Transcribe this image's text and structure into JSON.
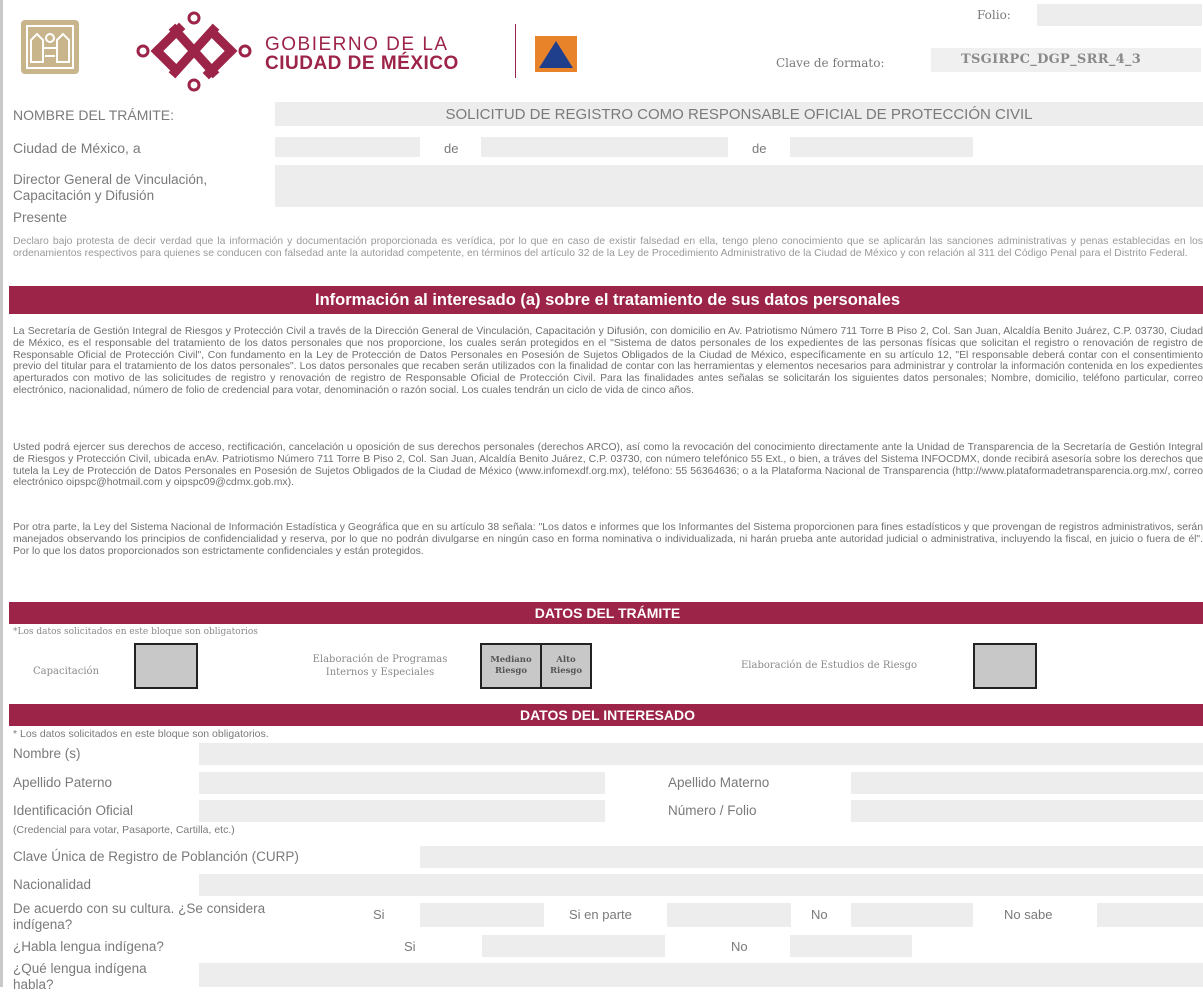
{
  "header": {
    "gov_line1": "GOBIERNO DE LA",
    "gov_line2": "CIUDAD DE MÉXICO",
    "folio_label": "Folio:",
    "folio_value": "",
    "clave_label": "Clave de formato:",
    "clave_value": "TSGIRPC_DGP_SRR_4_3",
    "colors": {
      "brand": "#9d2449",
      "logo_orange": "#e8832a",
      "logo_blue": "#1f3f8c"
    }
  },
  "tramite": {
    "label": "NOMBRE DEL TRÁMITE:",
    "value": "SOLICITUD DE REGISTRO COMO RESPONSABLE OFICIAL DE PROTECCIÓN CIVIL"
  },
  "fecha": {
    "label": "Ciudad de México, a",
    "de1": "de",
    "de2": "de"
  },
  "director": {
    "label_line1": "Director General de Vinculación,",
    "label_line2": "Capacitación y Difusión"
  },
  "presente": "Presente",
  "declaracion": "Declaro bajo protesta de decir verdad que la información y documentación proporcionada es verídica, por lo que en caso de existir falsedad en ella, tengo pleno conocimiento que se aplicarán las sanciones administrativas y penas establecidas en los ordenamientos respectivos para quienes se conducen con falsedad ante la autoridad competente, en términos del artículo 32 de la Ley de Procedimiento Administrativo de la Ciudad de México y con relación al 311 del Código Penal para el Distrito Federal.",
  "privacidad": {
    "title": "Información al interesado (a) sobre el tratamiento de sus datos personales",
    "p1": "La Secretaría de Gestión Integral de Riesgos y Protección Civil a través de la Dirección General de Vinculación, Capacitación y Difusión, con domicilio en Av. Patriotismo Número 711 Torre B Piso 2, Col. San Juan, Alcaldía Benito Juárez, C.P. 03730, Ciudad de México, es el responsable del tratamiento de los datos personales que nos proporcione, los cuales serán protegidos en el \"Sistema de datos personales de los expedientes de las personas físicas que solicitan el registro o renovación de registro de Responsable Oficial de Protección Civil\", Con fundamento en la Ley de Protección de Datos Personales en Posesión de Sujetos Obligados de la Ciudad de México, específicamente en su artículo 12, \"El responsable deberá contar con el consentimiento previo del titular para el tratamiento de los datos personales\". Los datos personales que recaben serán utilizados con la finalidad de contar con las herramientas y elementos necesarios para administrar y controlar la información contenida en los expedientes aperturados con motivo de las solicitudes de registro y renovación de registro de Responsable Oficial de Protección Civil. Para las finalidades antes señalas se solicitarán los siguientes datos personales; Nombre, domicilio, teléfono particular, correo electrónico, nacionalidad, número de folio de credencial para votar, denominación o razón social. Los cuales tendrán un ciclo de vida de cinco años.",
    "p2": "Usted podrá ejercer sus derechos de acceso, rectificación, cancelación u oposición de sus derechos personales (derechos ARCO), así como la revocación del conocimiento directamente ante la Unidad de Transparencia de la Secretaría de Gestión Integral de Riesgos y Protección Civil, ubicada enAv. Patriotismo Número 711 Torre B Piso 2, Col. San Juan, Alcaldía Benito Juárez, C.P. 03730, con número telefónico 55 Ext., o bien, a tráves del Sistema INFOCDMX, donde recibirá asesoría sobre los derechos que tutela la Ley de Protección de Datos Personales en Posesión de Sujetos Obligados de la Ciudad de México (www.infomexdf.org.mx), teléfono: 55 56364636; o a la Plataforma Nacional de Transparencia (http://www.plataformadetransparencia.org.mx/, correo electrónico oipspc@hotmail.com y oipspc09@cdmx.gob.mx).",
    "p3": "Por otra parte, la Ley del Sistema Nacional de Información Estadística y Geográfica que en su artículo 38 señala: \"Los datos e informes que los Informantes del Sistema proporcionen para fines estadísticos y que provengan de registros administrativos, serán manejados observando los principios de confidencialidad y reserva, por lo que no podrán divulgarse en ningún caso en forma nominativa o individualizada, ni harán prueba ante autoridad judicial o administrativa, incluyendo la  fiscal, en juicio o fuera de él\". Por lo que los datos proporcionados son estrictamente confidenciales y están protegidos."
  },
  "datos_tramite": {
    "title": "DATOS DEL TRÁMITE",
    "note": "*Los datos solicitados en este bloque son obligatorios",
    "capacitacion": "Capacitación",
    "programas_line1": "Elaboración de Programas",
    "programas_line2": "Internos y Especiales",
    "mediano_line1": "Mediano",
    "mediano_line2": "Riesgo",
    "alto_line1": "Alto",
    "alto_line2": "Riesgo",
    "estudios": "Elaboración de Estudios de Riesgo"
  },
  "datos_interesado": {
    "title": "DATOS DEL INTERESADO",
    "note": "* Los datos solicitados en este bloque son obligatorios.",
    "nombre": "Nombre (s)",
    "apellido_paterno": "Apellido Paterno",
    "apellido_materno": "Apellido Materno",
    "identificacion": "Identificación Oficial",
    "numero_folio": "Número / Folio",
    "identificacion_nota": "(Credencial para votar, Pasaporte, Cartilla, etc.)",
    "curp": "Clave Única de Registro de Poblanción (CURP)",
    "nacionalidad": "Nacionalidad",
    "indigena_line1": "De acuerdo con su cultura. ¿Se considera",
    "indigena_line2": "indígena?",
    "si": "Si",
    "si_en_parte": "Si en parte",
    "no": "No",
    "no_sabe": "No sabe",
    "lengua": "¿Habla lengua indígena?",
    "lengua_si": "Si",
    "lengua_no": "No",
    "que_lengua_line1": "¿Qué lengua indígena",
    "que_lengua_line2": "habla?"
  }
}
